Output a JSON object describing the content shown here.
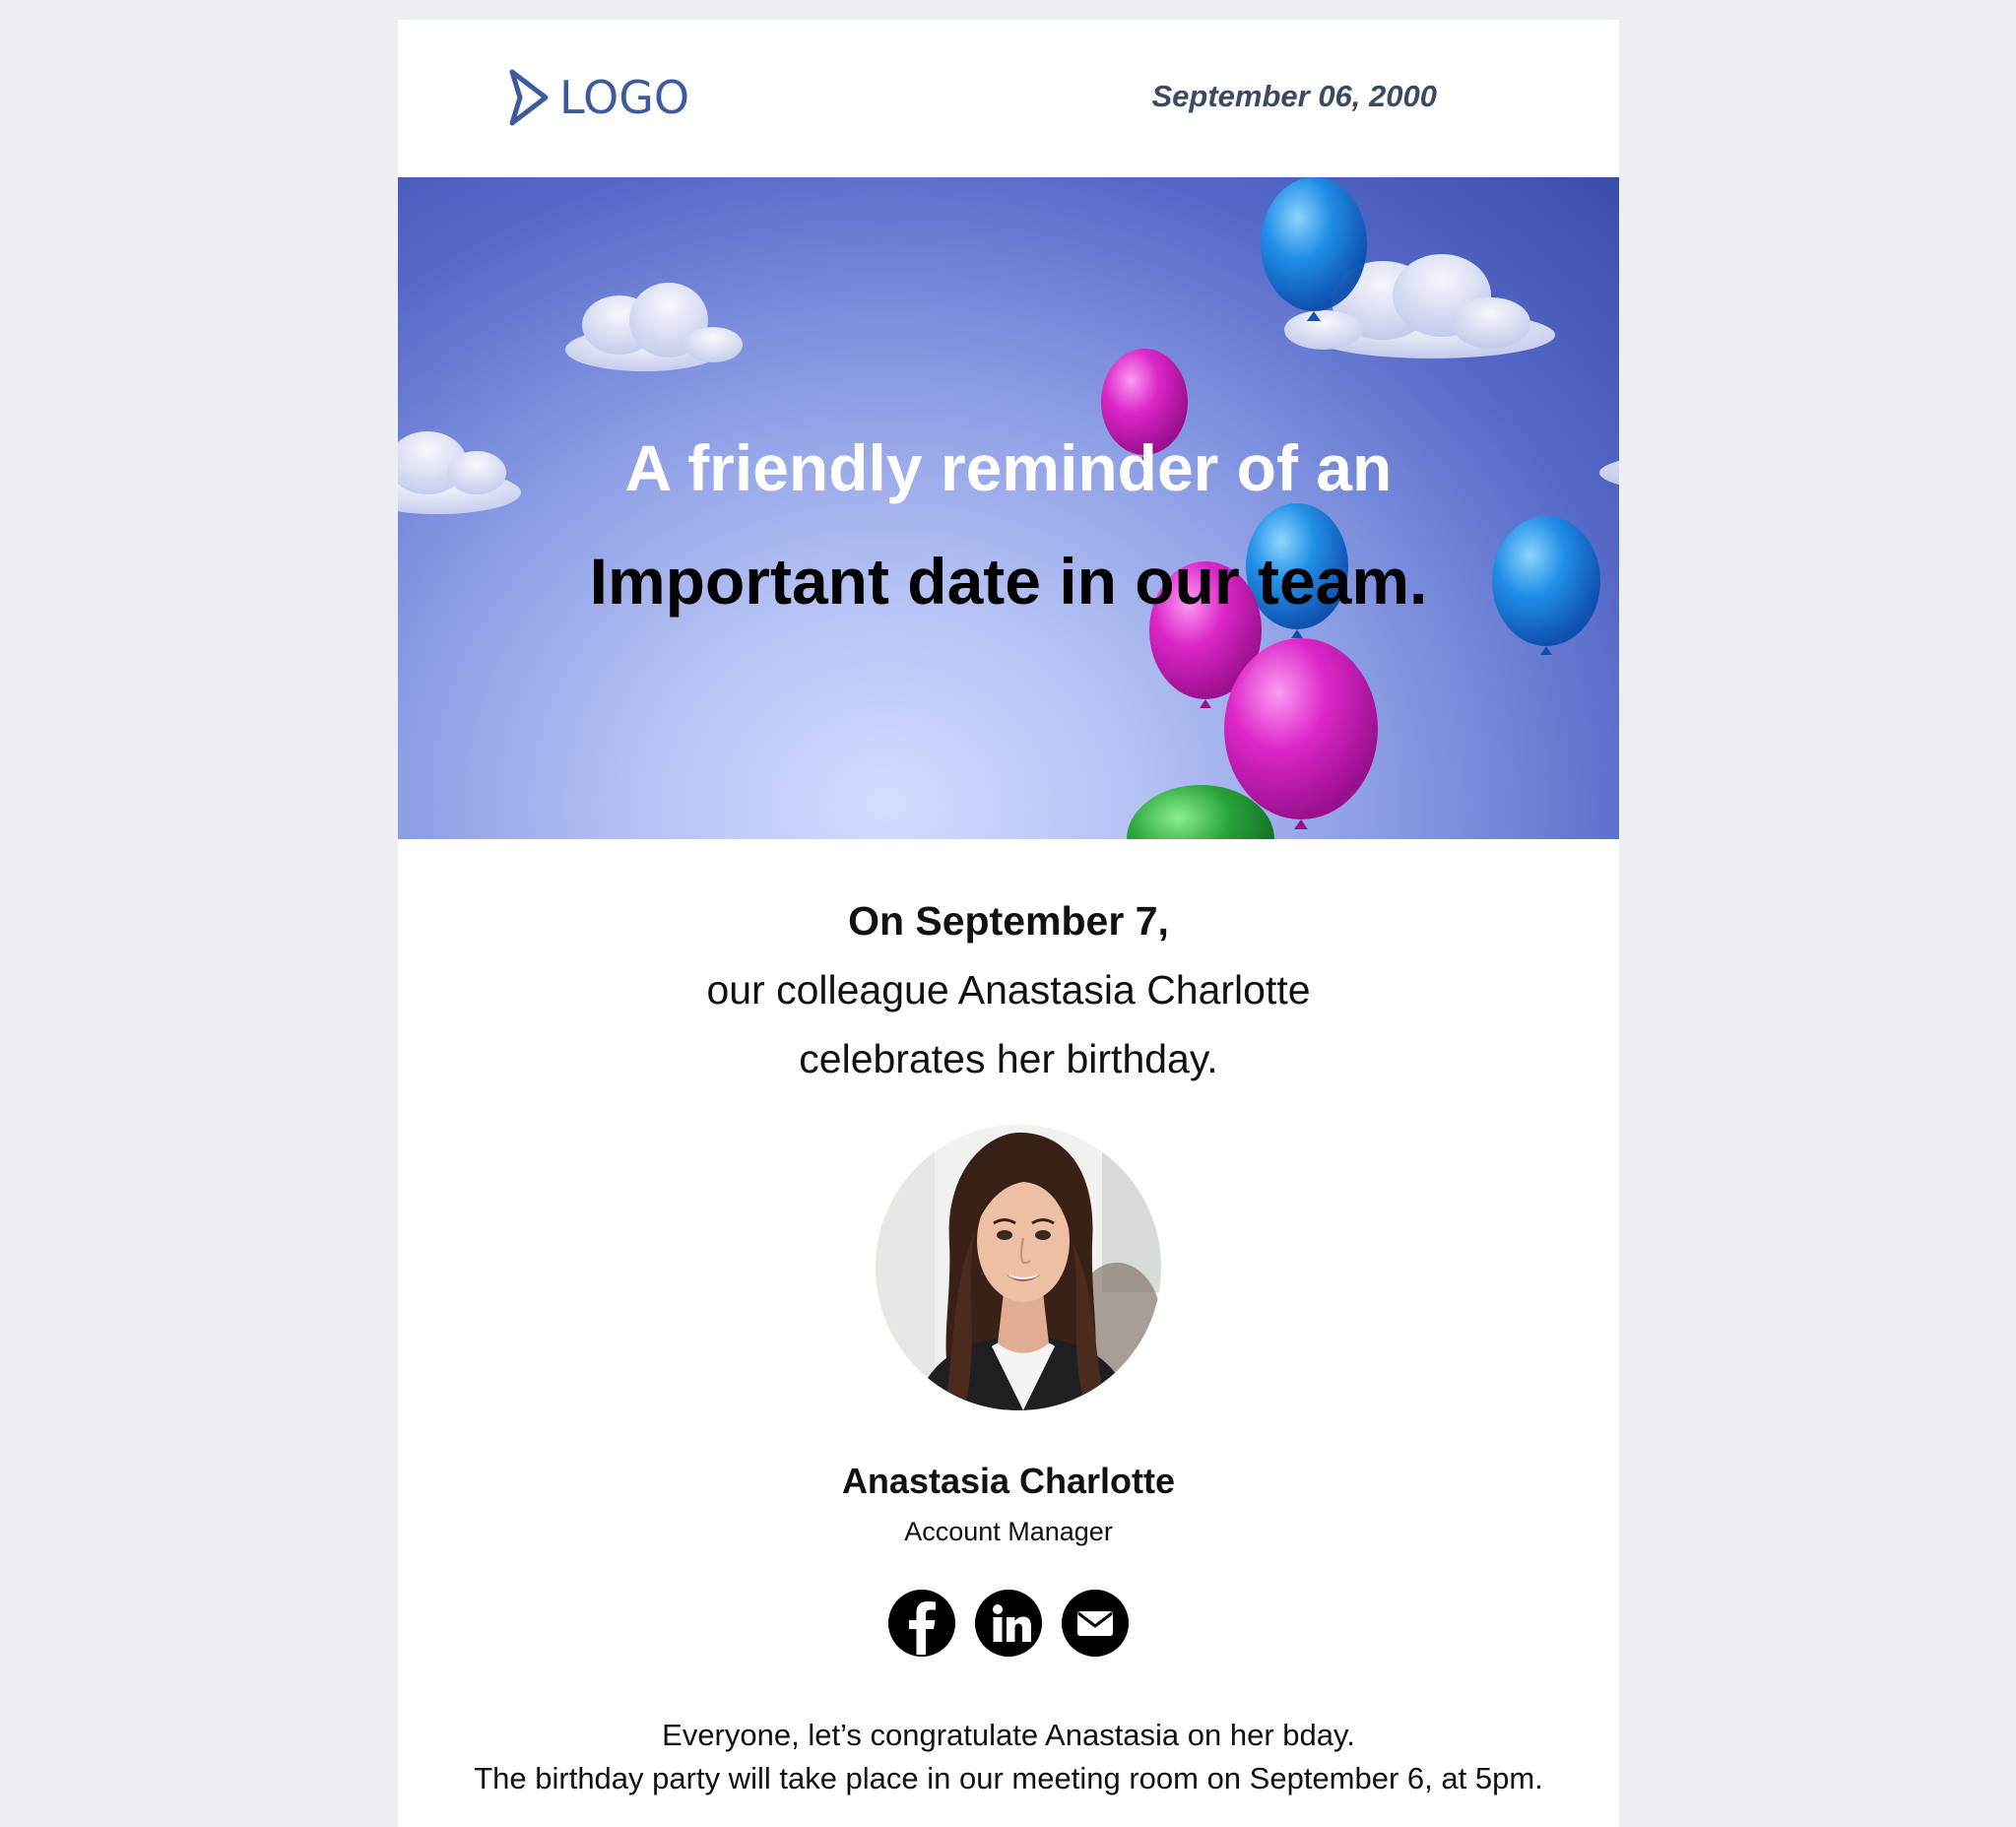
{
  "header": {
    "logo_text": "LOGO",
    "date": "September 06, 2000"
  },
  "hero": {
    "line1": "A friendly reminder of an",
    "line2": "Important date in our team."
  },
  "announcement": {
    "date_line": "On September 7,",
    "line2": "our colleague Anastasia Charlotte",
    "line3": "celebrates her birthday."
  },
  "person": {
    "name": "Anastasia Charlotte",
    "title": "Account Manager"
  },
  "socials": [
    {
      "icon": "facebook-icon"
    },
    {
      "icon": "linkedin-icon"
    },
    {
      "icon": "email-icon"
    }
  ],
  "footer": {
    "line1": "Everyone, let’s congratulate Anastasia on her bday.",
    "line2": "The birthday party will take place in our meeting room on September 6, at 5pm."
  },
  "colors": {
    "page_background": "#eceff1",
    "logo_blue": "#3d5a9e",
    "date_text": "#3b4a63"
  }
}
